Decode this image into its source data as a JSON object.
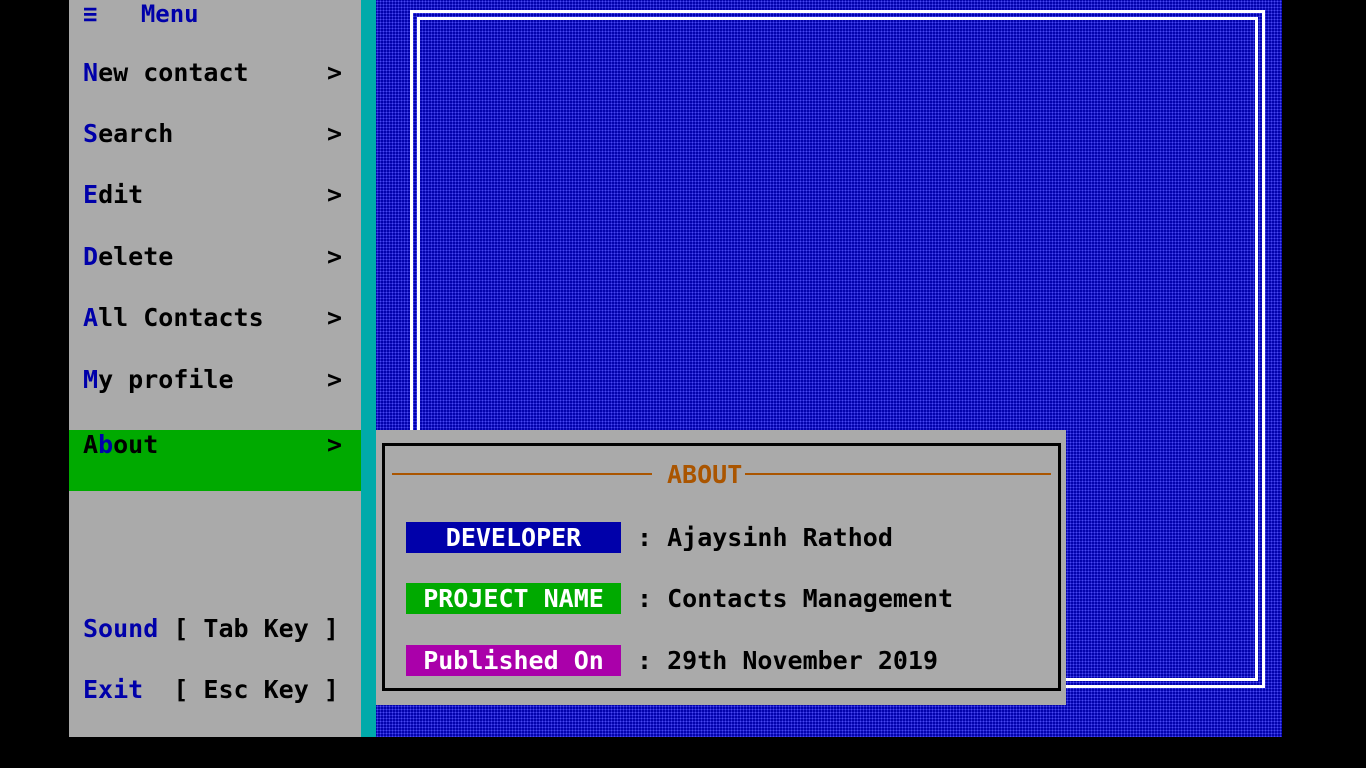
{
  "menu": {
    "icon": "hamburger-icon",
    "icon_glyph": "≡",
    "title": "Menu",
    "items": [
      {
        "hot": "N",
        "rest": "ew contact",
        "arrow": ">"
      },
      {
        "hot": "S",
        "rest": "earch",
        "arrow": ">"
      },
      {
        "hot": "E",
        "rest": "dit",
        "arrow": ">"
      },
      {
        "hot": "D",
        "rest": "elete",
        "arrow": ">"
      },
      {
        "hot": "A",
        "rest": "ll Contacts",
        "arrow": ">"
      },
      {
        "hot": "M",
        "rest": "y profile",
        "arrow": ">"
      },
      {
        "hot": "A",
        "rest": "bout",
        "arrow": ">",
        "mid": "b",
        "pre": "A",
        "post": "out",
        "active": true
      }
    ]
  },
  "footer": {
    "sound_label": "Sound",
    "sound_key": "[ Tab Key ]",
    "exit_label": "Exit",
    "exit_key": "[ Esc Key ]"
  },
  "about": {
    "title": "ABOUT",
    "developer_tag": "DEVELOPER",
    "developer_value": ": Ajaysinh Rathod",
    "project_tag": "PROJECT NAME",
    "project_value": ": Contacts Management",
    "published_tag": "Published On",
    "published_value": ": 29th November 2019"
  },
  "colors": {
    "menu_bg": "#aaaaaa",
    "active_bg": "#00aa00",
    "desktop_bg": "#0000aa",
    "hotkey": "#0000aa",
    "about_title": "#aa5500"
  }
}
